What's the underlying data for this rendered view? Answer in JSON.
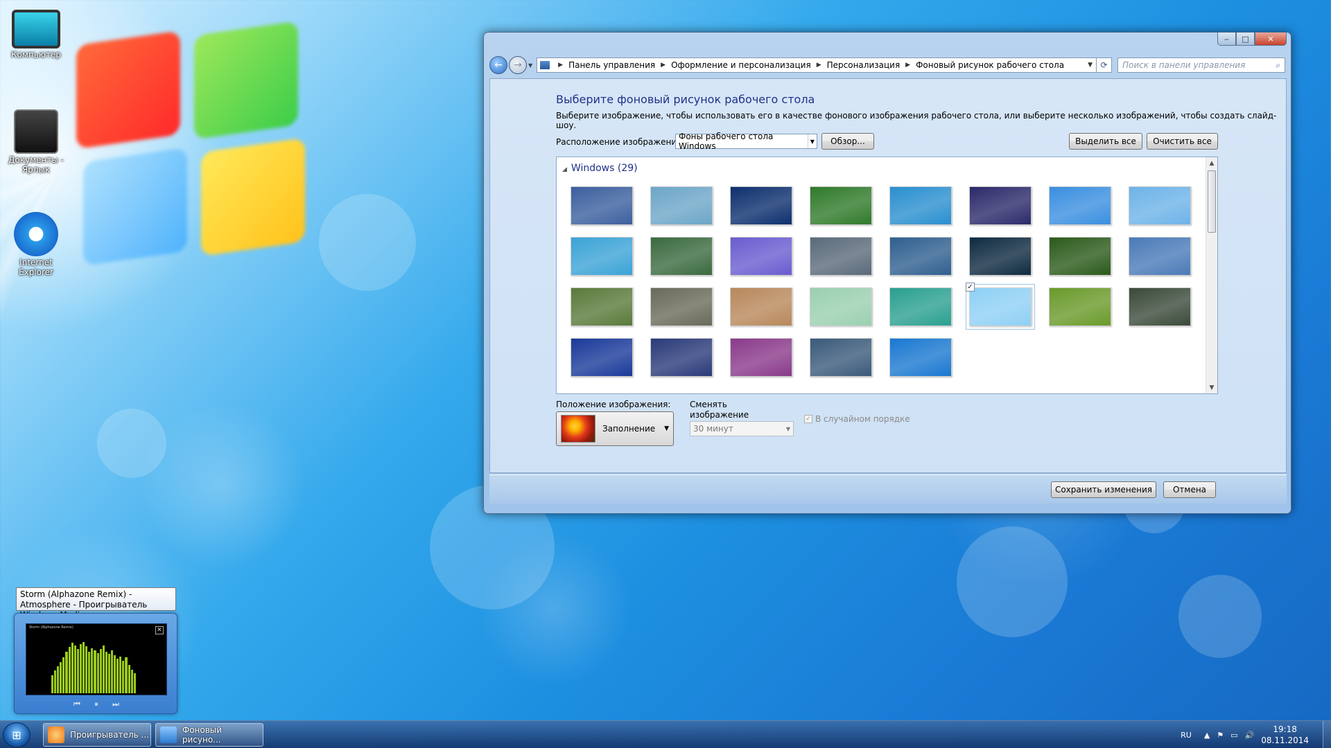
{
  "desktop": {
    "icons": [
      {
        "label": "Компьютер",
        "icon": "computer-icon"
      },
      {
        "label": "Документы - Ярлык",
        "icon": "documents-shortcut-icon"
      },
      {
        "label": "Internet Explorer",
        "icon": "internet-explorer-icon"
      }
    ]
  },
  "window": {
    "caption_buttons": {
      "minimize": "‒",
      "maximize": "□",
      "close": "✕"
    },
    "address_bar": {
      "crumbs": [
        "Панель управления",
        "Оформление и персонализация",
        "Персонализация",
        "Фоновый рисунок рабочего стола"
      ]
    },
    "search_placeholder": "Поиск в панели управления",
    "title": "Выберите фоновый рисунок рабочего стола",
    "subtitle": "Выберите изображение, чтобы использовать его в качестве фонового изображения рабочего стола, или выберите несколько изображений, чтобы создать слайд-шоу.",
    "location_label": "Расположение изображения:",
    "location_value": "Фоны рабочего стола Windows",
    "browse_label": "Обзор...",
    "select_all_label": "Выделить все",
    "clear_all_label": "Очистить все",
    "gallery": {
      "group_label": "Windows (29)",
      "selected_index": 21,
      "thumbs": [
        "#3b5f9e",
        "#6ca6c8",
        "#0d2f6e",
        "#2f7a2a",
        "#2a8fcf",
        "#2b2a6a",
        "#3a8fe0",
        "#6db3e8",
        "#3ba3d6",
        "#3a6a3e",
        "#6a5cd0",
        "#5a6a7a",
        "#2f5f8f",
        "#0e2a40",
        "#2a5a1a",
        "#4a7ab8",
        "#5a7a3a",
        "#6a6a5a",
        "#b8885a",
        "#9ad0b0",
        "#2aa090",
        "#8fd0f5",
        "#6a9a2a",
        "#3a4a3a",
        "#1a3a9a",
        "#2a3a7a",
        "#8a3a8a",
        "#3a5a7a",
        "#1a78d0"
      ]
    },
    "position_label": "Положение изображения:",
    "position_value": "Заполнение",
    "interval_label": "Сменять изображение каждые:",
    "interval_value": "30 минут",
    "shuffle_label": "В случайном порядке",
    "save_label": "Сохранить изменения",
    "cancel_label": "Отмена"
  },
  "media_player": {
    "tooltip": "Storm (Alphazone Remix) - Atmosphere - Проигрыватель Windows Media",
    "screen_title": "Storm (Alphazone Remix)",
    "close_glyph": "✕",
    "controls": {
      "prev": "⏮",
      "pause": "⏸",
      "next": "⏭"
    }
  },
  "taskbar": {
    "start_glyph": "⊞",
    "buttons": [
      {
        "label": "Проигрыватель ...",
        "icon": "media-player-icon",
        "color": "#f07a1a"
      },
      {
        "label": "Фоновый рисуно...",
        "icon": "desktop-background-icon",
        "color": "#2a7ad0"
      }
    ],
    "language": "RU",
    "tray_icons": [
      "▲",
      "⚑",
      "▭",
      "🔊"
    ],
    "time": "19:18",
    "date": "08.11.2014"
  },
  "colors": {
    "accent_title": "#1e3287",
    "window_frame": "#a9c8ea"
  }
}
